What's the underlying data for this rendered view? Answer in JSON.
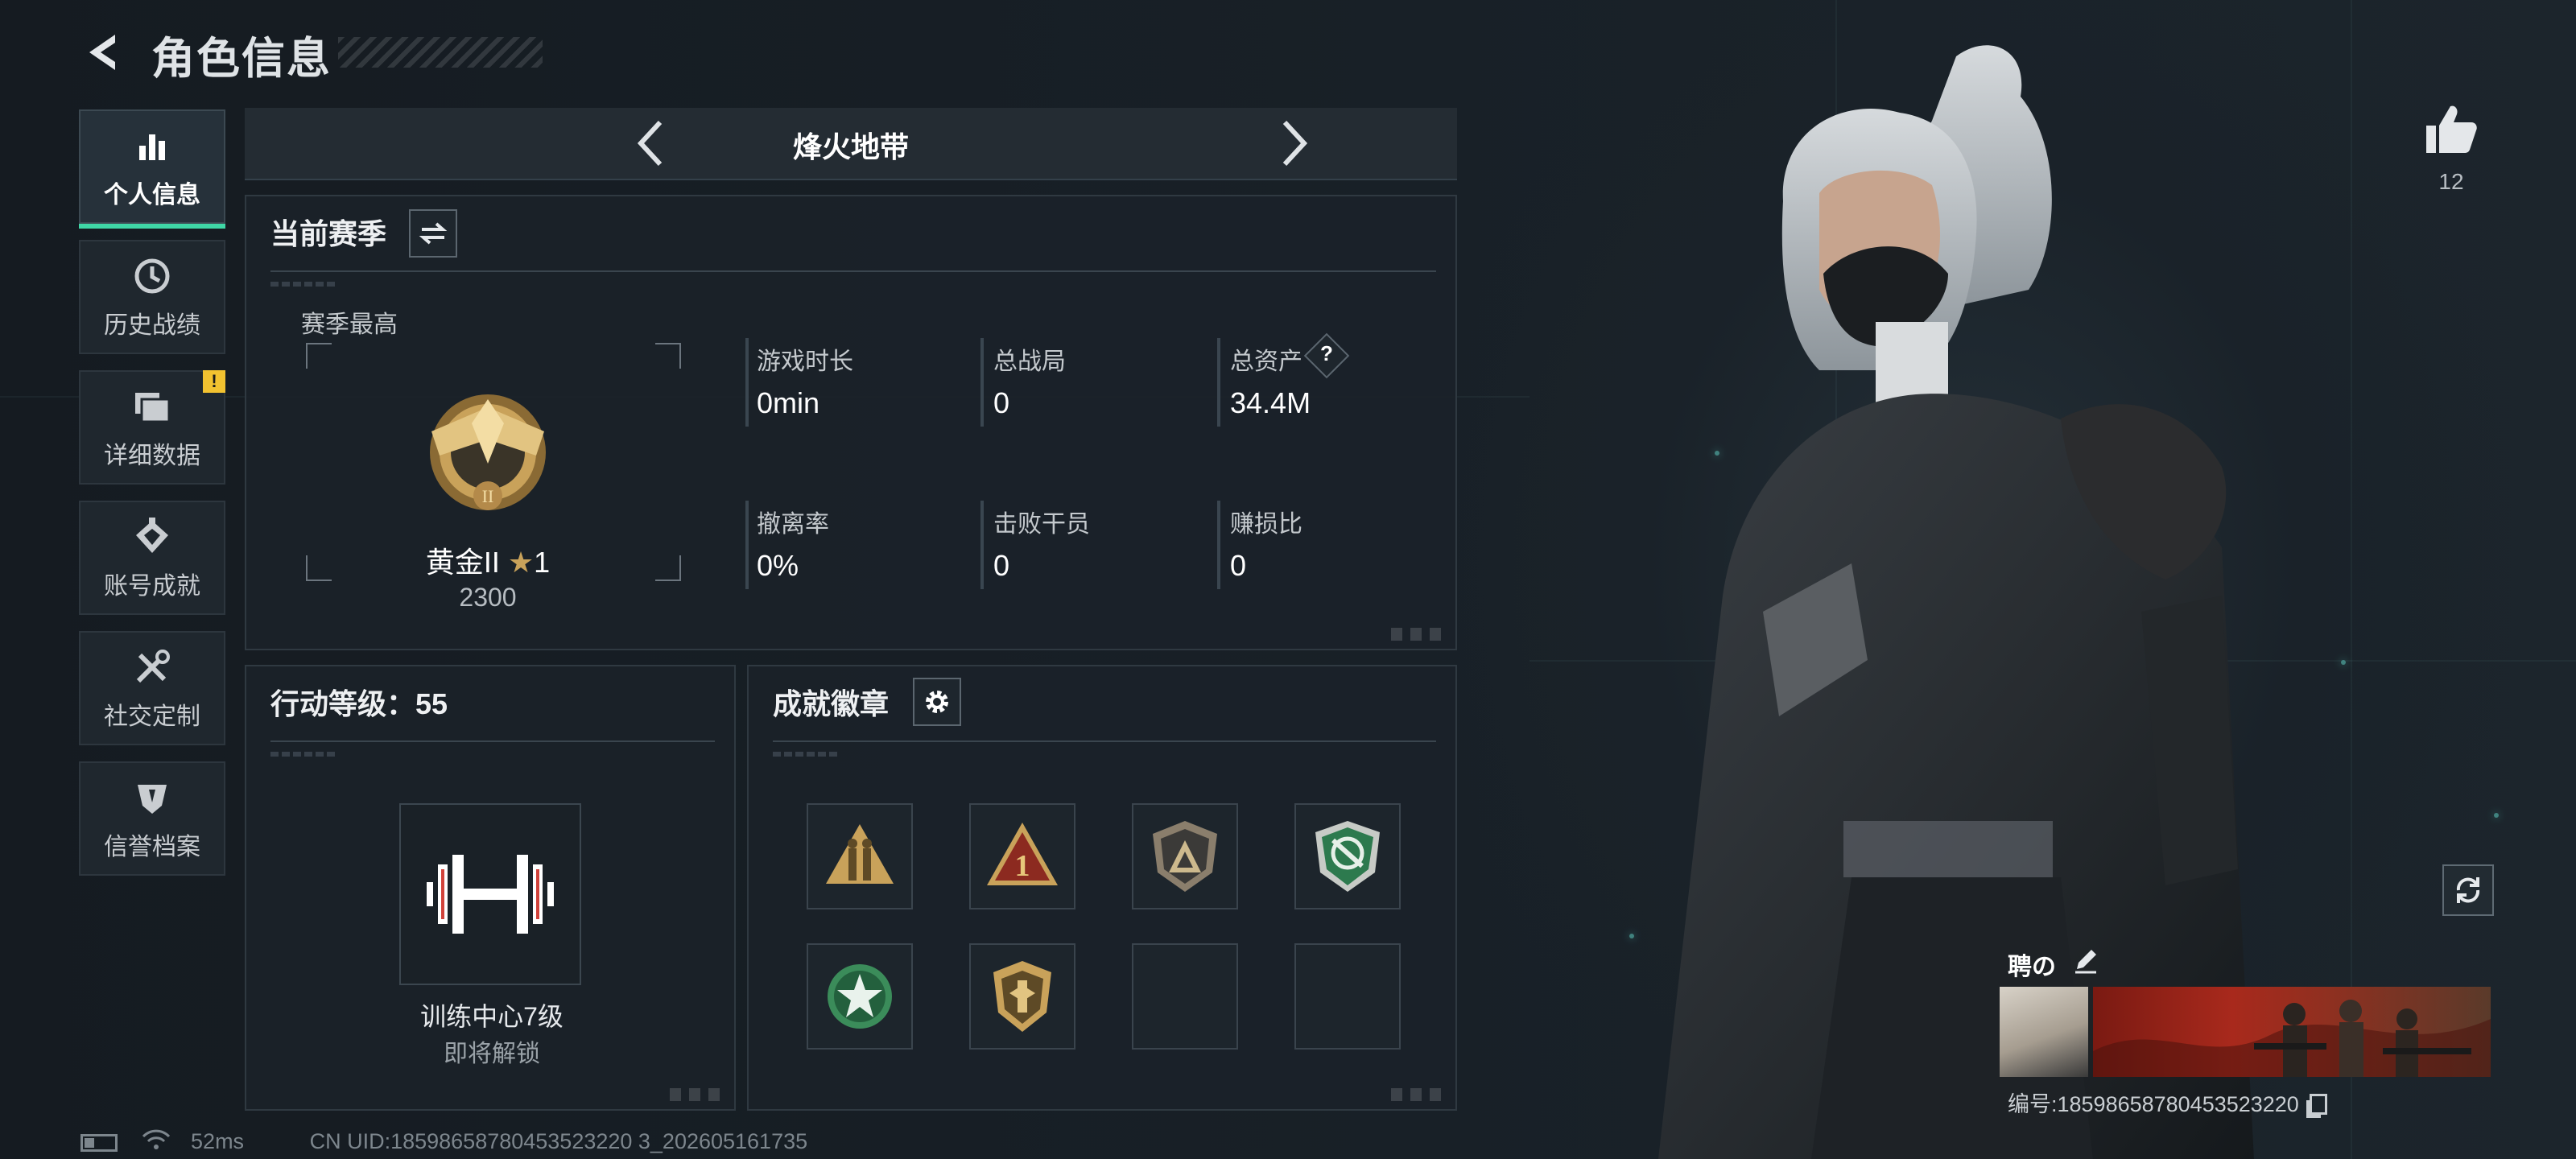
{
  "header": {
    "title": "角色信息"
  },
  "sidebar": {
    "items": [
      {
        "label": "个人信息",
        "icon": "bar-chart-icon",
        "active": true
      },
      {
        "label": "历史战绩",
        "icon": "clock-icon"
      },
      {
        "label": "详细数据",
        "icon": "folders-icon",
        "badge": "!"
      },
      {
        "label": "账号成就",
        "icon": "achievement-icon"
      },
      {
        "label": "社交定制",
        "icon": "tools-icon"
      },
      {
        "label": "信誉档案",
        "icon": "shield-icon"
      }
    ]
  },
  "mode": {
    "title": "烽火地带"
  },
  "season": {
    "header": "当前赛季",
    "best_label": "赛季最高",
    "rank_name": "黄金II",
    "rank_stars": "1",
    "rank_score": "2300",
    "stats": [
      {
        "label": "游戏时长",
        "value": "0min"
      },
      {
        "label": "总战局",
        "value": "0"
      },
      {
        "label": "总资产",
        "value": "34.4M",
        "help": "?"
      },
      {
        "label": "撤离率",
        "value": "0%"
      },
      {
        "label": "击败干员",
        "value": "0"
      },
      {
        "label": "赚损比",
        "value": "0"
      }
    ]
  },
  "action_level": {
    "label": "行动等级：",
    "value": "55",
    "unlock_title": "训练中心7级",
    "unlock_status": "即将解锁"
  },
  "badges": {
    "header": "成就徽章",
    "slots": [
      "badge-soldiers",
      "badge-triangle-1",
      "badge-shield-a",
      "badge-green-shield",
      "badge-green-star",
      "badge-gold-shield",
      "",
      ""
    ]
  },
  "profile": {
    "likes": "12",
    "name": "聘の",
    "serial": "编号:18598658780453523220"
  },
  "status_bar": {
    "ping": "52ms",
    "uid": "CN UID:18598658780453523220 3_202605161735"
  },
  "colors": {
    "accent": "#3fd7a6",
    "warning": "#f2c230",
    "gold": "#c9a25a"
  }
}
